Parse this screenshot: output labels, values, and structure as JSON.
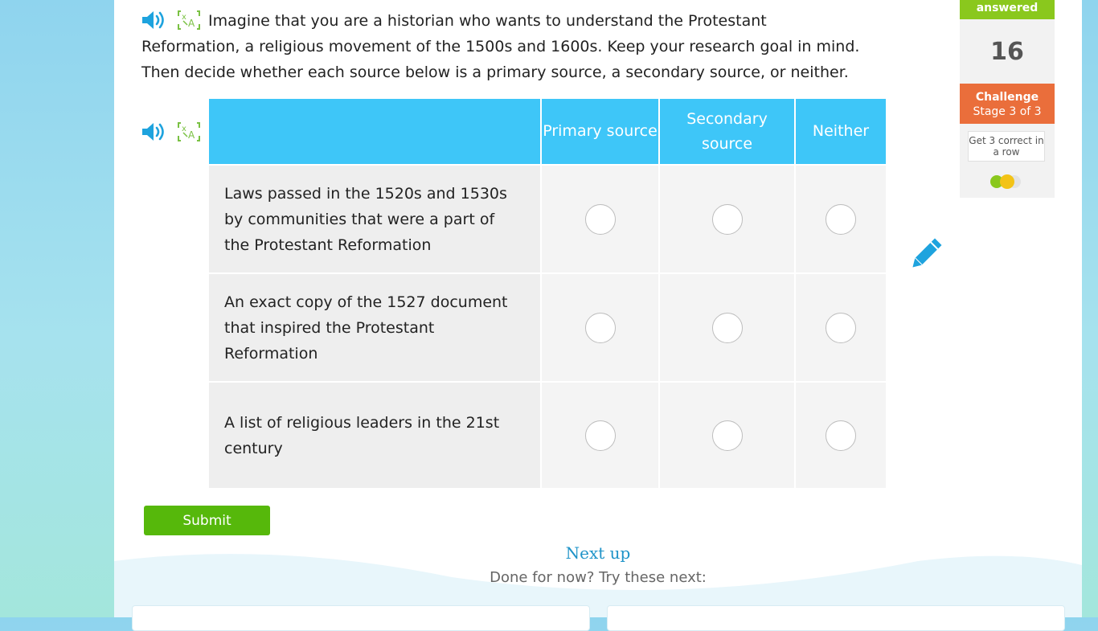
{
  "question": {
    "text": "Imagine that you are a historian who wants to understand the Protestant Reformation, a religious movement of the 1500s and 1600s. Keep your research goal in mind. Then decide whether each source below is a primary source, a secondary source, or neither."
  },
  "icons": {
    "speaker": "speaker-icon",
    "translate": "translate-icon",
    "pencil": "pencil-icon"
  },
  "table": {
    "columns": [
      "Primary source",
      "Secondary source",
      "Neither"
    ],
    "rows": [
      "Laws passed in the 1520s and 1530s by communities that were a part of the Protestant Reformation",
      "An exact copy of the 1527 document that inspired the Protestant Reformation",
      "A list of religious leaders in the 21st century"
    ]
  },
  "submit_label": "Submit",
  "next_up": {
    "title": "Next up",
    "subtitle": "Done for now? Try these next:"
  },
  "sidebar": {
    "answered_label": "answered",
    "answered_count": "16",
    "challenge_title": "Challenge",
    "challenge_stage": "Stage 3 of 3",
    "goal": "Get 3 correct in a row",
    "progress_correct": 1,
    "progress_total": 3
  },
  "colors": {
    "accent": "#3ec6f8",
    "submit": "#56b80b",
    "challenge": "#ea6e3b",
    "answered": "#8ac81d"
  }
}
